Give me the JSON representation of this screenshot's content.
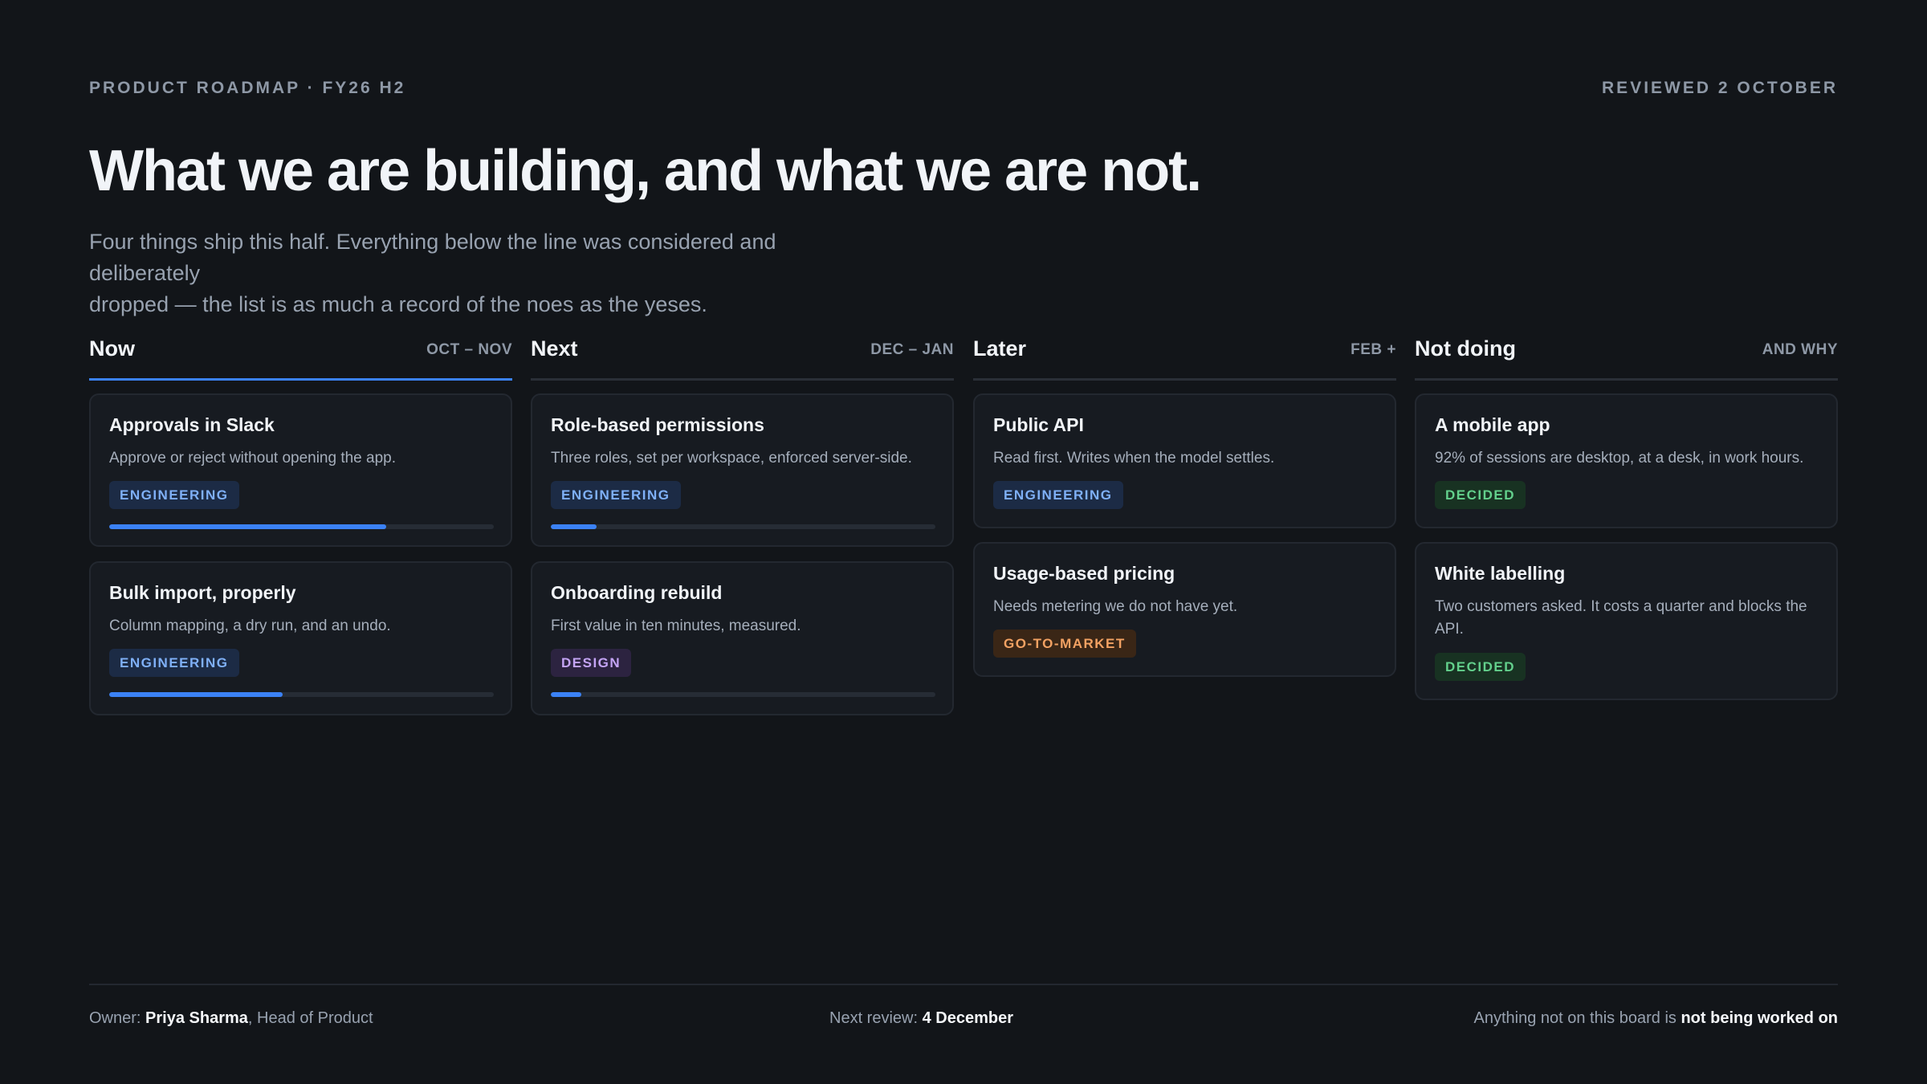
{
  "header": {
    "eyebrow": "PRODUCT ROADMAP · FY26 H2",
    "reviewed": "REVIEWED 2 OCTOBER",
    "title": "What we are building, and what we are not.",
    "subtitle_line1": "Four things ship this half. Everything below the line was considered and deliberately",
    "subtitle_line2": "dropped — the list is as much a record of the noes as the yeses."
  },
  "columns": [
    {
      "title": "Now",
      "range": "OCT – NOV",
      "cards": [
        {
          "title": "Approvals in Slack",
          "desc": "Approve or reject without opening the app.",
          "tag": "ENGINEERING",
          "progress": 0.72
        },
        {
          "title": "Bulk import, properly",
          "desc": "Column mapping, a dry run, and an undo.",
          "tag": "ENGINEERING",
          "progress": 0.45
        }
      ]
    },
    {
      "title": "Next",
      "range": "DEC – JAN",
      "cards": [
        {
          "title": "Role-based permissions",
          "desc": "Three roles, set per workspace, enforced server-side.",
          "tag": "ENGINEERING",
          "progress": 0.12
        },
        {
          "title": "Onboarding rebuild",
          "desc": "First value in ten minutes, measured.",
          "tag": "DESIGN",
          "progress": 0.08
        }
      ]
    },
    {
      "title": "Later",
      "range": "FEB +",
      "cards": [
        {
          "title": "Public API",
          "desc": "Read first. Writes when the model settles.",
          "tag": "ENGINEERING"
        },
        {
          "title": "Usage-based pricing",
          "desc": "Needs metering we do not have yet.",
          "tag": "GO-TO-MARKET"
        }
      ]
    },
    {
      "title": "Not doing",
      "range": "AND WHY",
      "cards": [
        {
          "title": "A mobile app",
          "desc": "92% of sessions are desktop, at a desk, in work hours.",
          "tag": "DECIDED"
        },
        {
          "title": "White labelling",
          "desc": "Two customers asked. It costs a quarter and blocks the API.",
          "tag": "DECIDED"
        }
      ]
    }
  ],
  "footer": {
    "owner_label": "Owner: ",
    "owner_name": "Priya Sharma",
    "owner_role": ", Head of Product",
    "next_review_label": "Next review: ",
    "next_review_date": "4 December",
    "note_prefix": "Anything not on this board is ",
    "note_emphasis": "not being worked on"
  },
  "colors": {
    "background": "#121519",
    "accent": "#3b82f6",
    "engineering": "#7fb0f7",
    "design": "#c4a4f5",
    "go_to_market": "#f3a263",
    "decided": "#63d08c"
  }
}
